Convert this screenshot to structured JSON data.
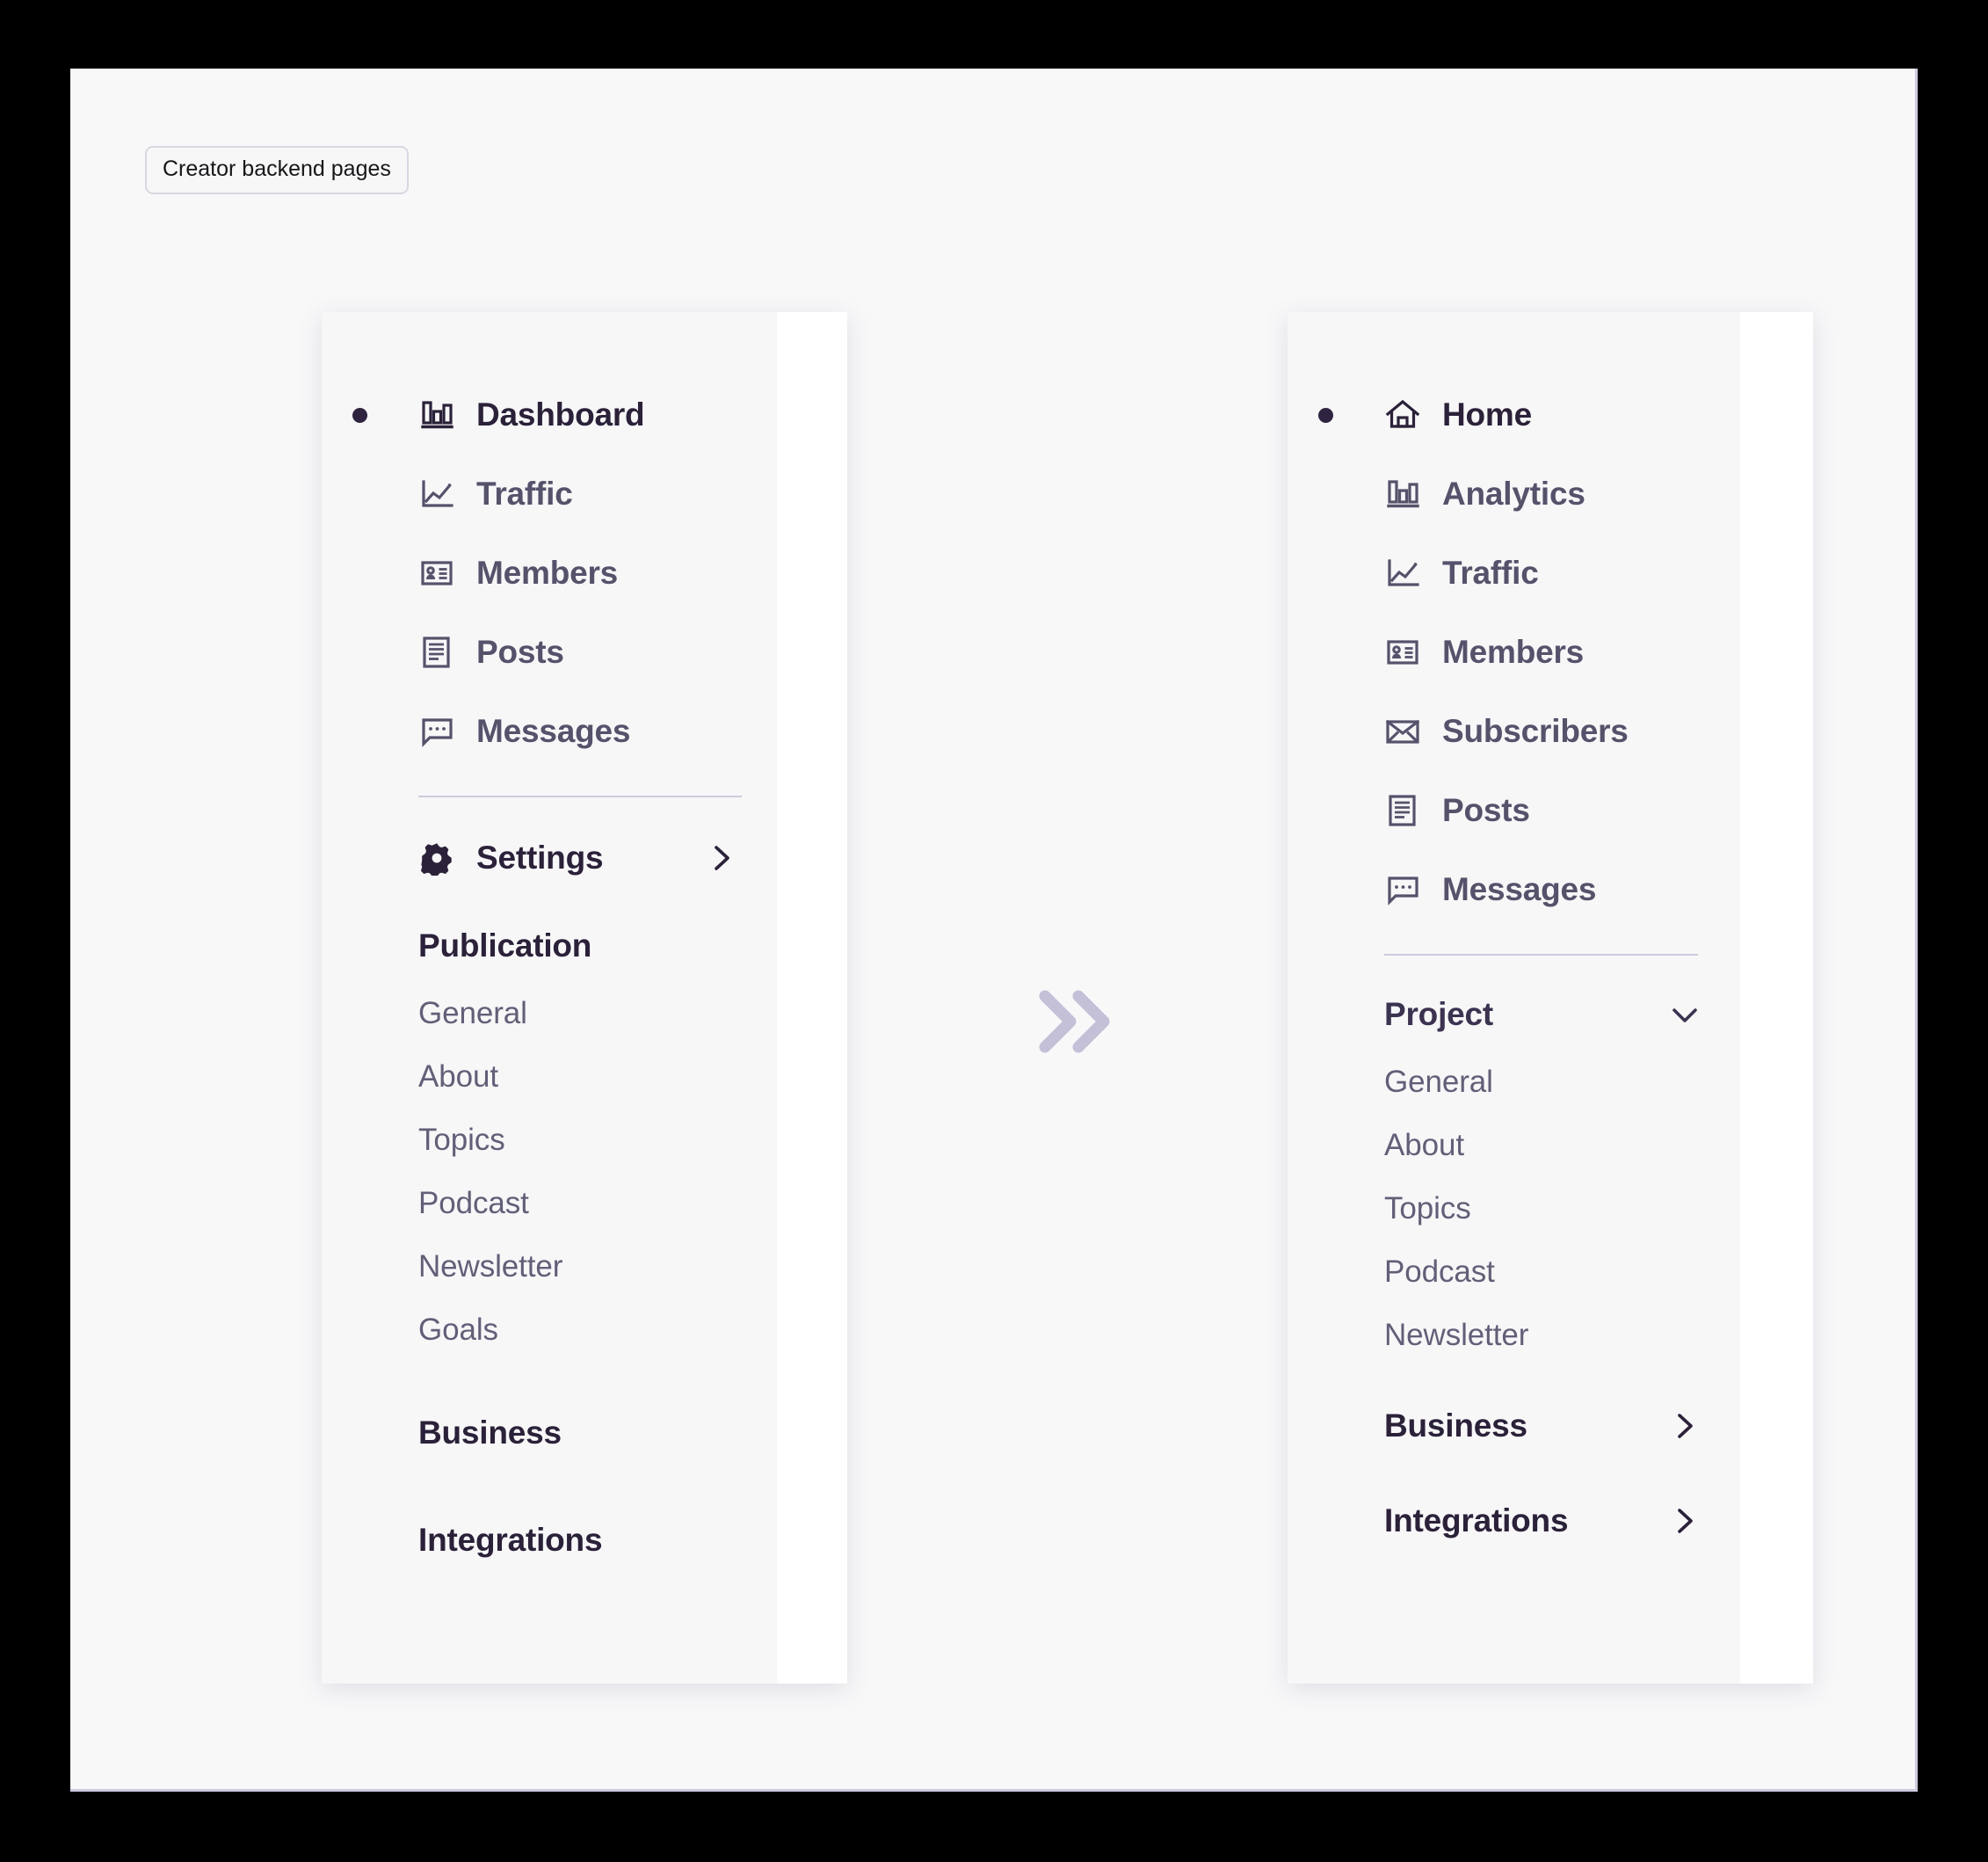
{
  "annotation": {
    "label": "Creator backend pages"
  },
  "colors": {
    "panel_bg": "#f7f7f8",
    "panel_white": "#ffffff",
    "active_text": "#2b2139",
    "nav_text": "#55526b",
    "sub_text": "#625f78",
    "divider": "#cfcbde",
    "arrow": "#c3c0d8",
    "bullet": "#2f2440"
  },
  "left_panel": {
    "name": "current-navigation",
    "nav_items": [
      {
        "label": "Dashboard",
        "icon": "bar-chart-icon",
        "active": true
      },
      {
        "label": "Traffic",
        "icon": "line-chart-icon",
        "active": false
      },
      {
        "label": "Members",
        "icon": "id-card-icon",
        "active": false
      },
      {
        "label": "Posts",
        "icon": "document-icon",
        "active": false
      },
      {
        "label": "Messages",
        "icon": "chat-bubble-icon",
        "active": false
      }
    ],
    "settings": {
      "label": "Settings",
      "icon": "gear-icon",
      "chevron": "chevron-right-icon"
    },
    "sections": [
      {
        "label": "Publication",
        "chevron": "",
        "items": [
          "General",
          "About",
          "Topics",
          "Podcast",
          "Newsletter",
          "Goals"
        ]
      },
      {
        "label": "Business",
        "chevron": "",
        "items": []
      },
      {
        "label": "Integrations",
        "chevron": "",
        "items": []
      }
    ]
  },
  "right_panel": {
    "name": "proposed-navigation",
    "nav_items": [
      {
        "label": "Home",
        "icon": "home-icon",
        "active": true
      },
      {
        "label": "Analytics",
        "icon": "bar-chart-icon",
        "active": false
      },
      {
        "label": "Traffic",
        "icon": "line-chart-icon",
        "active": false
      },
      {
        "label": "Members",
        "icon": "id-card-icon",
        "active": false
      },
      {
        "label": "Subscribers",
        "icon": "envelope-icon",
        "active": false
      },
      {
        "label": "Posts",
        "icon": "document-icon",
        "active": false
      },
      {
        "label": "Messages",
        "icon": "chat-bubble-icon",
        "active": false
      }
    ],
    "sections": [
      {
        "label": "Project",
        "chevron": "chevron-down-icon",
        "items": [
          "General",
          "About",
          "Topics",
          "Podcast",
          "Newsletter"
        ]
      },
      {
        "label": "Business",
        "chevron": "chevron-right-icon",
        "items": []
      },
      {
        "label": "Integrations",
        "chevron": "chevron-right-icon",
        "items": []
      }
    ]
  },
  "transition": {
    "icon": "double-chevron-right-icon"
  }
}
